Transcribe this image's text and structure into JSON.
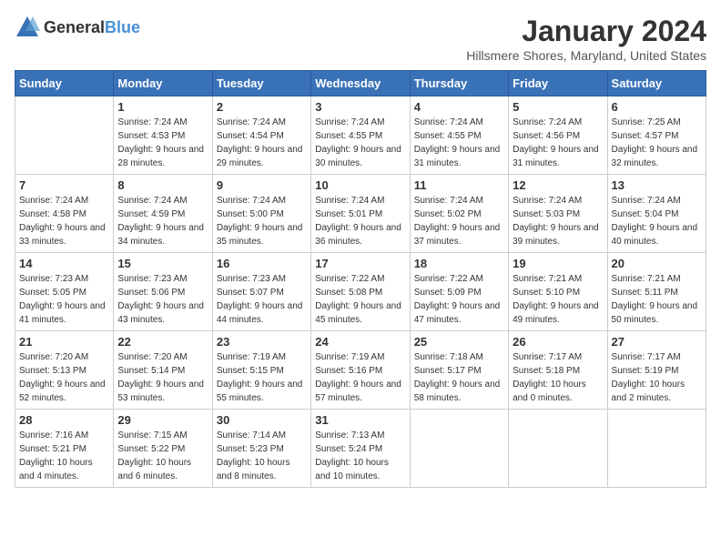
{
  "header": {
    "logo_general": "General",
    "logo_blue": "Blue",
    "month": "January 2024",
    "location": "Hillsmere Shores, Maryland, United States"
  },
  "days_of_week": [
    "Sunday",
    "Monday",
    "Tuesday",
    "Wednesday",
    "Thursday",
    "Friday",
    "Saturday"
  ],
  "weeks": [
    [
      {
        "day": "",
        "sunrise": "",
        "sunset": "",
        "daylight": ""
      },
      {
        "day": "1",
        "sunrise": "7:24 AM",
        "sunset": "4:53 PM",
        "daylight": "9 hours and 28 minutes."
      },
      {
        "day": "2",
        "sunrise": "7:24 AM",
        "sunset": "4:54 PM",
        "daylight": "9 hours and 29 minutes."
      },
      {
        "day": "3",
        "sunrise": "7:24 AM",
        "sunset": "4:55 PM",
        "daylight": "9 hours and 30 minutes."
      },
      {
        "day": "4",
        "sunrise": "7:24 AM",
        "sunset": "4:55 PM",
        "daylight": "9 hours and 31 minutes."
      },
      {
        "day": "5",
        "sunrise": "7:24 AM",
        "sunset": "4:56 PM",
        "daylight": "9 hours and 31 minutes."
      },
      {
        "day": "6",
        "sunrise": "7:25 AM",
        "sunset": "4:57 PM",
        "daylight": "9 hours and 32 minutes."
      }
    ],
    [
      {
        "day": "7",
        "sunrise": "7:24 AM",
        "sunset": "4:58 PM",
        "daylight": "9 hours and 33 minutes."
      },
      {
        "day": "8",
        "sunrise": "7:24 AM",
        "sunset": "4:59 PM",
        "daylight": "9 hours and 34 minutes."
      },
      {
        "day": "9",
        "sunrise": "7:24 AM",
        "sunset": "5:00 PM",
        "daylight": "9 hours and 35 minutes."
      },
      {
        "day": "10",
        "sunrise": "7:24 AM",
        "sunset": "5:01 PM",
        "daylight": "9 hours and 36 minutes."
      },
      {
        "day": "11",
        "sunrise": "7:24 AM",
        "sunset": "5:02 PM",
        "daylight": "9 hours and 37 minutes."
      },
      {
        "day": "12",
        "sunrise": "7:24 AM",
        "sunset": "5:03 PM",
        "daylight": "9 hours and 39 minutes."
      },
      {
        "day": "13",
        "sunrise": "7:24 AM",
        "sunset": "5:04 PM",
        "daylight": "9 hours and 40 minutes."
      }
    ],
    [
      {
        "day": "14",
        "sunrise": "7:23 AM",
        "sunset": "5:05 PM",
        "daylight": "9 hours and 41 minutes."
      },
      {
        "day": "15",
        "sunrise": "7:23 AM",
        "sunset": "5:06 PM",
        "daylight": "9 hours and 43 minutes."
      },
      {
        "day": "16",
        "sunrise": "7:23 AM",
        "sunset": "5:07 PM",
        "daylight": "9 hours and 44 minutes."
      },
      {
        "day": "17",
        "sunrise": "7:22 AM",
        "sunset": "5:08 PM",
        "daylight": "9 hours and 45 minutes."
      },
      {
        "day": "18",
        "sunrise": "7:22 AM",
        "sunset": "5:09 PM",
        "daylight": "9 hours and 47 minutes."
      },
      {
        "day": "19",
        "sunrise": "7:21 AM",
        "sunset": "5:10 PM",
        "daylight": "9 hours and 49 minutes."
      },
      {
        "day": "20",
        "sunrise": "7:21 AM",
        "sunset": "5:11 PM",
        "daylight": "9 hours and 50 minutes."
      }
    ],
    [
      {
        "day": "21",
        "sunrise": "7:20 AM",
        "sunset": "5:13 PM",
        "daylight": "9 hours and 52 minutes."
      },
      {
        "day": "22",
        "sunrise": "7:20 AM",
        "sunset": "5:14 PM",
        "daylight": "9 hours and 53 minutes."
      },
      {
        "day": "23",
        "sunrise": "7:19 AM",
        "sunset": "5:15 PM",
        "daylight": "9 hours and 55 minutes."
      },
      {
        "day": "24",
        "sunrise": "7:19 AM",
        "sunset": "5:16 PM",
        "daylight": "9 hours and 57 minutes."
      },
      {
        "day": "25",
        "sunrise": "7:18 AM",
        "sunset": "5:17 PM",
        "daylight": "9 hours and 58 minutes."
      },
      {
        "day": "26",
        "sunrise": "7:17 AM",
        "sunset": "5:18 PM",
        "daylight": "10 hours and 0 minutes."
      },
      {
        "day": "27",
        "sunrise": "7:17 AM",
        "sunset": "5:19 PM",
        "daylight": "10 hours and 2 minutes."
      }
    ],
    [
      {
        "day": "28",
        "sunrise": "7:16 AM",
        "sunset": "5:21 PM",
        "daylight": "10 hours and 4 minutes."
      },
      {
        "day": "29",
        "sunrise": "7:15 AM",
        "sunset": "5:22 PM",
        "daylight": "10 hours and 6 minutes."
      },
      {
        "day": "30",
        "sunrise": "7:14 AM",
        "sunset": "5:23 PM",
        "daylight": "10 hours and 8 minutes."
      },
      {
        "day": "31",
        "sunrise": "7:13 AM",
        "sunset": "5:24 PM",
        "daylight": "10 hours and 10 minutes."
      },
      {
        "day": "",
        "sunrise": "",
        "sunset": "",
        "daylight": ""
      },
      {
        "day": "",
        "sunrise": "",
        "sunset": "",
        "daylight": ""
      },
      {
        "day": "",
        "sunrise": "",
        "sunset": "",
        "daylight": ""
      }
    ]
  ]
}
